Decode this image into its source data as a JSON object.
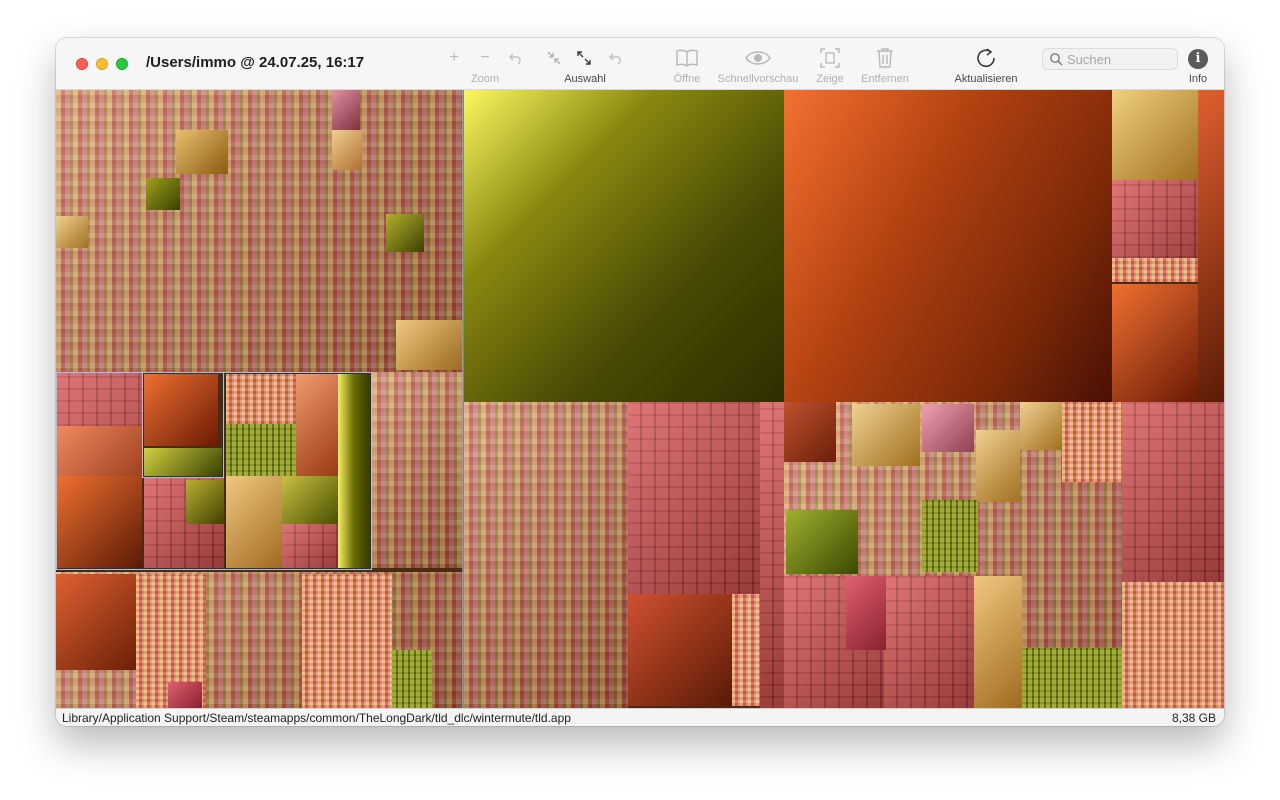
{
  "window": {
    "title": "/Users/immo @ 24.07.25, 16:17"
  },
  "toolbar": {
    "zoom_label": "Zoom",
    "auswahl_label": "Auswahl",
    "oeffne_label": "Öffne",
    "schnellvorschau_label": "Schnellvorschau",
    "zeige_label": "Zeige",
    "entfernen_label": "Entfernen",
    "aktualisieren_label": "Aktualisieren",
    "info_label": "Info",
    "icons": [
      "zoom-in-icon",
      "zoom-out-icon",
      "zoom-back-icon",
      "shrink-icon",
      "expand-icon",
      "selection-back-icon",
      "book-icon",
      "eye-icon",
      "reveal-icon",
      "trash-icon",
      "refresh-icon",
      "info-icon"
    ]
  },
  "search": {
    "placeholder": "Suchen",
    "value": ""
  },
  "statusbar": {
    "path": "Library/Application Support/Steam/steamapps/common/TheLongDark/tld_dlc/wintermute/tld.app",
    "size": "8,38 GB"
  },
  "colors": {
    "yellow_tile": "#f5f050",
    "olive_tile": "#3a3a05",
    "orange_tile": "#e86a30",
    "brown_tile": "#5a1a05",
    "selection_outline": "#9ac4f0"
  }
}
